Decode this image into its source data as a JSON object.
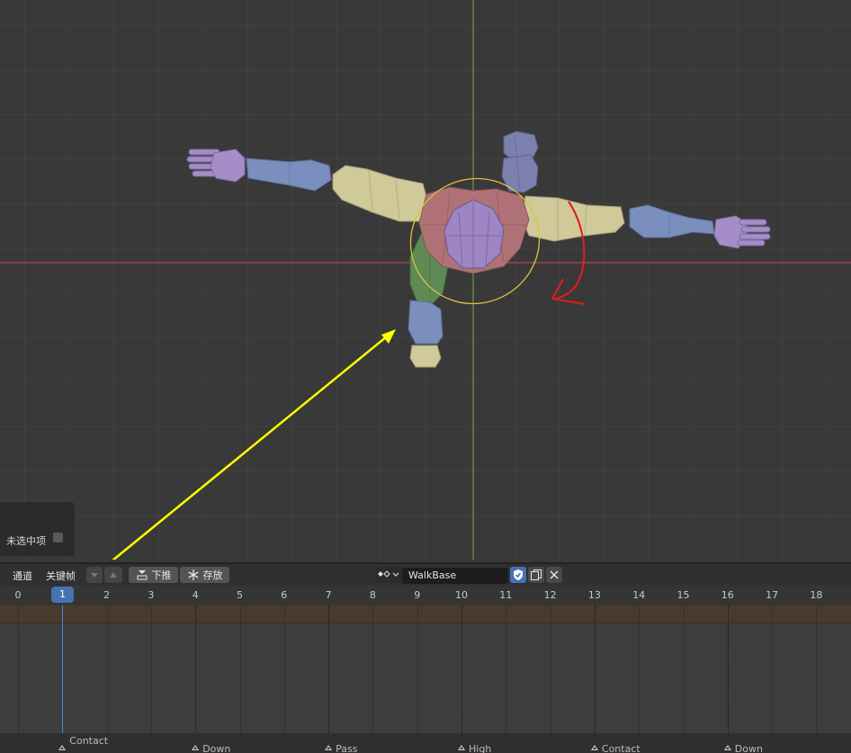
{
  "sidebar_panel": {
    "label": "未选中项"
  },
  "timeline": {
    "channel_menu": "通道",
    "keyframe_menu": "关键帧",
    "push_down_label": "下推",
    "stash_label": "存放",
    "action_name": "WalkBase",
    "current_frame": "1",
    "frame_labels": [
      "0",
      "2",
      "3",
      "4",
      "5",
      "6",
      "7",
      "8",
      "9",
      "10",
      "11",
      "12",
      "13",
      "14",
      "15",
      "16",
      "17",
      "18"
    ],
    "markers": [
      "Contact",
      "Down",
      "Pass",
      "High",
      "Contact",
      "Down"
    ]
  },
  "colors": {
    "accent": "#4772b3",
    "annotation_yellow": "#ffff00",
    "annotation_red": "#e01d1d",
    "x_axis": "#b8434b",
    "y_axis": "#6f9a30"
  }
}
